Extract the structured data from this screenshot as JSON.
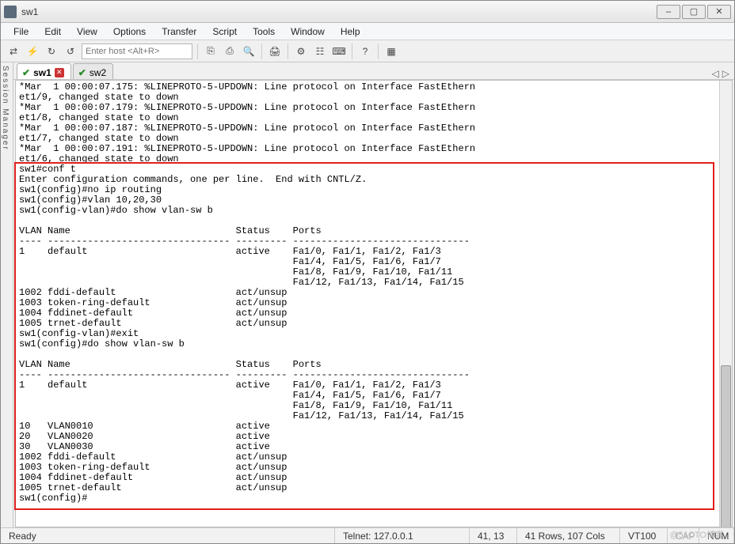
{
  "window": {
    "title": "sw1"
  },
  "win_btns": {
    "min": "–",
    "max": "▢",
    "close": "✕"
  },
  "menus": {
    "file": "File",
    "edit": "Edit",
    "view": "View",
    "options": "Options",
    "transfer": "Transfer",
    "script": "Script",
    "tools": "Tools",
    "window": "Window",
    "help": "Help"
  },
  "toolbar": {
    "host_placeholder": "Enter host <Alt+R>",
    "icons": {
      "reconnect": "⇄",
      "quick": "⚡",
      "loop": "↻",
      "loop2": "↺",
      "sep1": "",
      "copy": "⎘",
      "paste": "⎙",
      "find": "🔍",
      "sep2": "",
      "print": "🖨",
      "sep3": "",
      "settings": "⚙",
      "options": "☷",
      "keys": "⌨",
      "sep4": "",
      "help": "?",
      "sep5": "",
      "script": "▦"
    }
  },
  "sidebar": {
    "label": "Session Manager"
  },
  "tabs": {
    "t1": {
      "label": "sw1",
      "check": "✔",
      "close": "✕"
    },
    "t2": {
      "label": "sw2",
      "check": "✔"
    },
    "nav": {
      "prev": "◁",
      "next": "▷"
    }
  },
  "terminal_lines": [
    "*Mar  1 00:00:07.175: %LINEPROTO-5-UPDOWN: Line protocol on Interface FastEthern",
    "et1/9, changed state to down",
    "*Mar  1 00:00:07.179: %LINEPROTO-5-UPDOWN: Line protocol on Interface FastEthern",
    "et1/8, changed state to down",
    "*Mar  1 00:00:07.187: %LINEPROTO-5-UPDOWN: Line protocol on Interface FastEthern",
    "et1/7, changed state to down",
    "*Mar  1 00:00:07.191: %LINEPROTO-5-UPDOWN: Line protocol on Interface FastEthern",
    "et1/6, changed state to down",
    "sw1#conf t",
    "Enter configuration commands, one per line.  End with CNTL/Z.",
    "sw1(config)#no ip routing",
    "sw1(config)#vlan 10,20,30",
    "sw1(config-vlan)#do show vlan-sw b",
    "",
    "VLAN Name                             Status    Ports",
    "---- -------------------------------- --------- -------------------------------",
    "1    default                          active    Fa1/0, Fa1/1, Fa1/2, Fa1/3",
    "                                                Fa1/4, Fa1/5, Fa1/6, Fa1/7",
    "                                                Fa1/8, Fa1/9, Fa1/10, Fa1/11",
    "                                                Fa1/12, Fa1/13, Fa1/14, Fa1/15",
    "1002 fddi-default                     act/unsup",
    "1003 token-ring-default               act/unsup",
    "1004 fddinet-default                  act/unsup",
    "1005 trnet-default                    act/unsup",
    "sw1(config-vlan)#exit",
    "sw1(config)#do show vlan-sw b",
    "",
    "VLAN Name                             Status    Ports",
    "---- -------------------------------- --------- -------------------------------",
    "1    default                          active    Fa1/0, Fa1/1, Fa1/2, Fa1/3",
    "                                                Fa1/4, Fa1/5, Fa1/6, Fa1/7",
    "                                                Fa1/8, Fa1/9, Fa1/10, Fa1/11",
    "                                                Fa1/12, Fa1/13, Fa1/14, Fa1/15",
    "10   VLAN0010                         active",
    "20   VLAN0020                         active",
    "30   VLAN0030                         active",
    "1002 fddi-default                     act/unsup",
    "1003 token-ring-default               act/unsup",
    "1004 fddinet-default                  act/unsup",
    "1005 trnet-default                    act/unsup",
    "sw1(config)#"
  ],
  "statusbar": {
    "ready": "Ready",
    "conn": "Telnet: 127.0.0.1",
    "pos": "41,  13",
    "size": "41 Rows, 107 Cols",
    "emul": "VT100",
    "cap": "CAP",
    "num": "NUM"
  },
  "watermark": "@51CTO博客"
}
